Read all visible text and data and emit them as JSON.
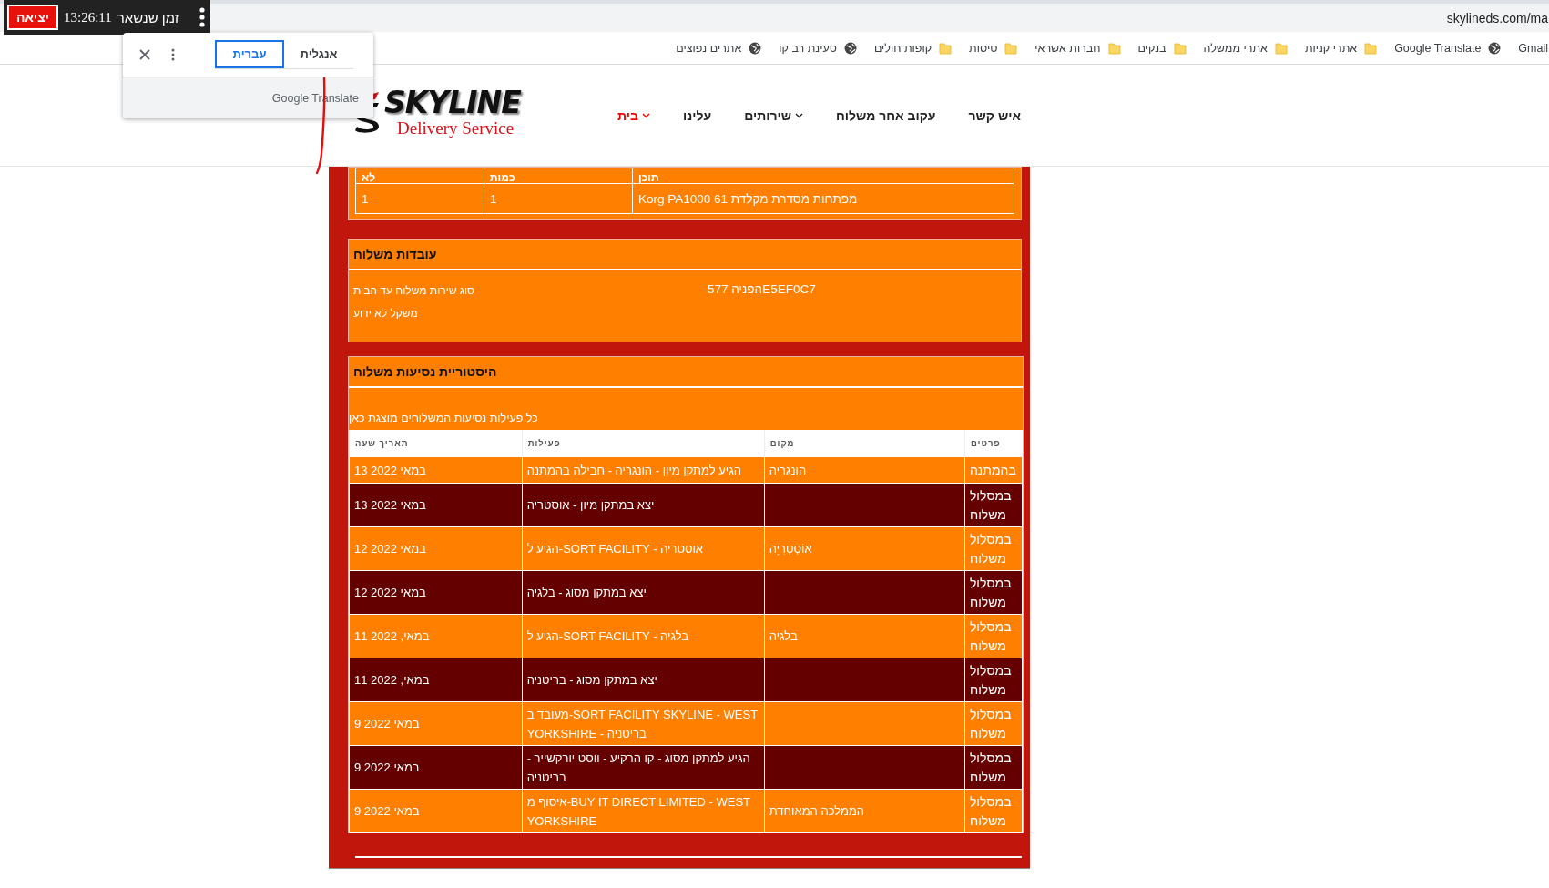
{
  "browser": {
    "address": "skylineds.com/ma",
    "bookmarks": [
      {
        "label": "Gmail"
      },
      {
        "label": "Google Translate",
        "kind": "globe"
      },
      {
        "label": "אתרי קניות",
        "kind": "folder"
      },
      {
        "label": "אתרי ממשלה",
        "kind": "folder"
      },
      {
        "label": "בנקים",
        "kind": "folder"
      },
      {
        "label": "חברות אשראי",
        "kind": "folder"
      },
      {
        "label": "טיסות",
        "kind": "folder"
      },
      {
        "label": "קופות חולים",
        "kind": "folder"
      },
      {
        "label": "טעינת רב קו",
        "kind": "globe"
      },
      {
        "label": "אתרים נפוצים",
        "kind": "globe"
      }
    ]
  },
  "timer_overlay": {
    "exit_button": "יציאה",
    "time": "13:26:11",
    "label": "זמן שנשאר"
  },
  "translate_popup": {
    "tabs": [
      {
        "label": "אנגלית",
        "selected": false
      },
      {
        "label": "עברית",
        "selected": true
      }
    ],
    "footer": "Google Translate"
  },
  "site": {
    "logo": {
      "name": "SKYLINE",
      "tagline": "Delivery Service"
    },
    "nav": [
      {
        "label": "איש קשר",
        "selected": false,
        "has_menu": false
      },
      {
        "label": "עקוב אחר משלוח",
        "selected": false,
        "has_menu": false
      },
      {
        "label": "שירותים",
        "selected": false,
        "has_menu": true
      },
      {
        "label": "עלינו",
        "selected": false,
        "has_menu": false
      },
      {
        "label": "בית",
        "selected": true,
        "has_menu": true
      }
    ]
  },
  "contents_table": {
    "columns": [
      "תוכן",
      "כמות",
      "לא"
    ],
    "rows": [
      [
        "Korg PA1000 61 מפתחות מסדרת מקלדת",
        "1",
        "1"
      ]
    ]
  },
  "shipment_facts": {
    "title": "עובדות משלוח",
    "reference": "הפניה 577E5EF0C7",
    "lines": [
      "סוג שירות משלוח עד הבית",
      "משקל לא ידוע"
    ]
  },
  "history": {
    "title": "היסטוריית נסיעות משלוח",
    "note": "כל פעילות נסיעות המשלוחים מוצגת כאן",
    "columns": [
      "פרטים",
      "מקום",
      "פעילות",
      "תאריך שעה"
    ],
    "rows": [
      [
        "בהמתנה",
        "הונגריה",
        "הגיע למתקן מיון - הונגריה - חבילה בהמתנה",
        "13 במאי 2022"
      ],
      [
        "במסלול משלוח",
        "",
        "יצא במתקן מיון - אוסטריה",
        "13 במאי 2022"
      ],
      [
        "במסלול משלוח",
        "אוֹסְטְרִיָה",
        "הגיע ל-SORT FACILITY - אוסטריה",
        "12 במאי 2022"
      ],
      [
        "במסלול משלוח",
        "",
        "יצא במתקן מסוג - בלגיה",
        "12 במאי 2022"
      ],
      [
        "במסלול משלוח",
        "בלגיה",
        "הגיע ל-SORT FACILITY - בלגיה",
        "11 במאי, 2022"
      ],
      [
        "במסלול משלוח",
        "",
        "יצא במתקן מסוג - בריטניה",
        "11 במאי, 2022"
      ],
      [
        "במסלול משלוח",
        "",
        "מעובד ב-SORT FACILITY SKYLINE - WEST YORKSHIRE - בריטניה",
        "9 במאי 2022"
      ],
      [
        "במסלול משלוח",
        "",
        "הגיע למתקן מסוג - קו הרקיע - ווסט יורקשייר - בריטניה",
        "9 במאי 2022"
      ],
      [
        "במסלול משלוח",
        "הממלכה המאוחדת",
        "איסוף מ-BUY IT DIRECT LIMITED - WEST YORKSHIRE",
        "9 במאי 2022"
      ]
    ]
  }
}
